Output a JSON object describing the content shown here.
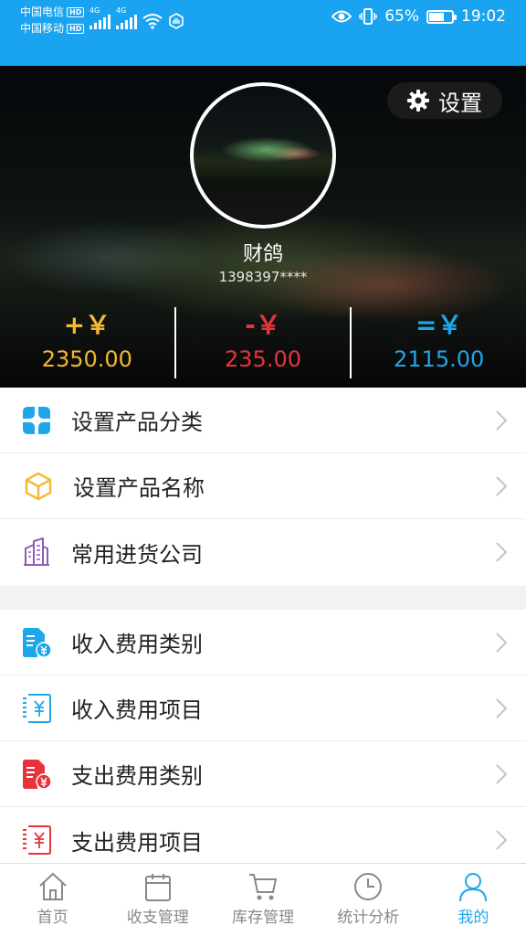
{
  "status_bar": {
    "carrier1": "中国电信",
    "carrier2": "中国移动",
    "hd": "HD",
    "net1": "4G",
    "net2": "4G",
    "battery_percent": "65%",
    "battery_level": 0.65,
    "time": "19:02"
  },
  "profile": {
    "settings_label": "设置",
    "username": "财鸽",
    "phone": "1398397****"
  },
  "stats": {
    "income_symbol": "+￥",
    "income_value": "2350.00",
    "expense_symbol": "-￥",
    "expense_value": "235.00",
    "balance_symbol": "=￥",
    "balance_value": "2115.00"
  },
  "menu_group1": [
    {
      "label": "设置产品分类",
      "icon": "category-grid-icon",
      "color": "#1ea6ec"
    },
    {
      "label": "设置产品名称",
      "icon": "box-icon",
      "color": "#f5b731"
    },
    {
      "label": "常用进货公司",
      "icon": "building-icon",
      "color": "#8e5ab8"
    }
  ],
  "menu_group2": [
    {
      "label": "收入费用类别",
      "icon": "income-category-icon",
      "color": "#1ea6ec"
    },
    {
      "label": "收入费用项目",
      "icon": "income-item-icon",
      "color": "#1ea6ec"
    },
    {
      "label": "支出费用类别",
      "icon": "expense-category-icon",
      "color": "#e8333d"
    },
    {
      "label": "支出费用项目",
      "icon": "expense-item-icon",
      "color": "#e8333d"
    }
  ],
  "bottom_nav": [
    {
      "label": "首页",
      "icon": "home-icon"
    },
    {
      "label": "收支管理",
      "icon": "calendar-icon"
    },
    {
      "label": "库存管理",
      "icon": "cart-icon"
    },
    {
      "label": "统计分析",
      "icon": "clock-icon"
    },
    {
      "label": "我的",
      "icon": "user-icon",
      "active": true
    }
  ],
  "colors": {
    "accent": "#1ea6ec",
    "status_bar": "#1aa3f0",
    "income": "#f5b731",
    "expense": "#e8333d",
    "balance": "#1ea6ec"
  }
}
